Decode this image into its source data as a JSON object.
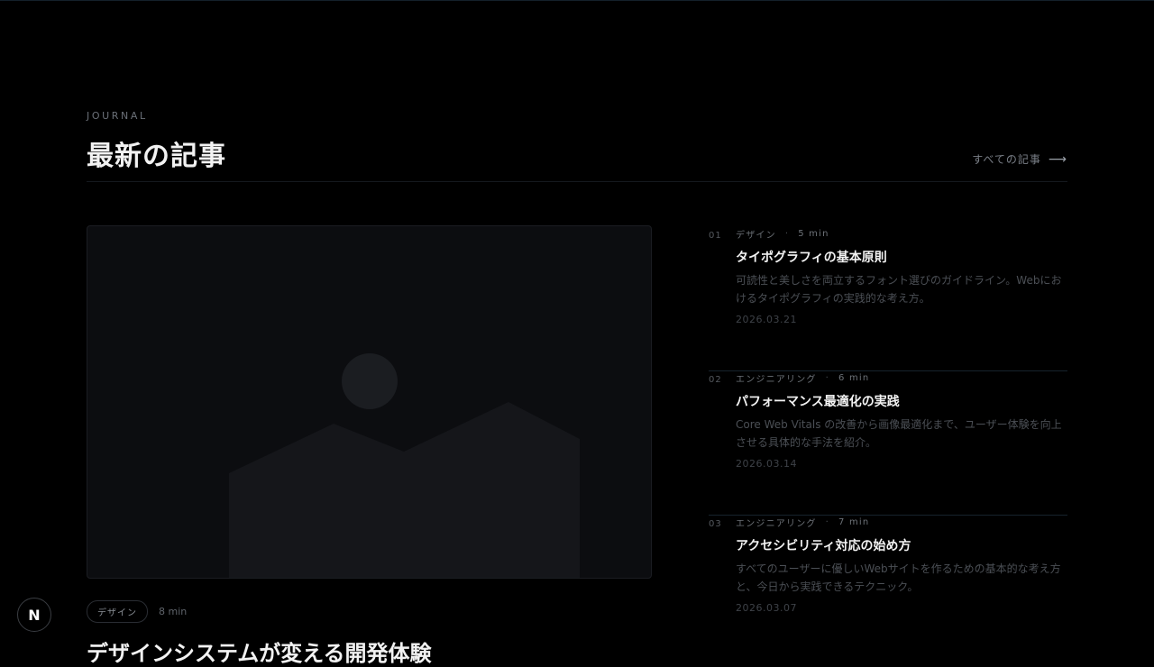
{
  "section": {
    "eyebrow": "JOURNAL",
    "heading": "最新の記事",
    "view_all": "すべての記事",
    "view_all_icon": "arrow-right-icon"
  },
  "featured": {
    "image_icon": "image-placeholder-icon",
    "tag": "デザイン",
    "read_time": "8 min",
    "title": "デザインシステムが変える開発体験"
  },
  "articles": [
    {
      "num": "01",
      "category": "デザイン",
      "separator": "·",
      "read_time": "5 min",
      "title": "タイポグラフィの基本原則",
      "excerpt": "可読性と美しさを両立するフォント選びのガイドライン。Webにおけるタイポグラフィの実践的な考え方。",
      "date": "2026.03.21"
    },
    {
      "num": "02",
      "category": "エンジニアリング",
      "separator": "·",
      "read_time": "6 min",
      "title": "パフォーマンス最適化の実践",
      "excerpt": "Core Web Vitals の改善から画像最適化まで、ユーザー体験を向上させる具体的な手法を紹介。",
      "date": "2026.03.14"
    },
    {
      "num": "03",
      "category": "エンジニアリング",
      "separator": "·",
      "read_time": "7 min",
      "title": "アクセシビリティ対応の始め方",
      "excerpt": "すべてのユーザーに優しいWebサイトを作るための基本的な考え方と、今日から実践できるテクニック。",
      "date": "2026.03.07"
    }
  ],
  "nav_badge": {
    "label": "N",
    "icon": "nextjs-logo-icon"
  },
  "colors": {
    "background": "#000000",
    "heading": "#f2f2f2",
    "muted": "#6b7078",
    "divider": "#16232c"
  }
}
